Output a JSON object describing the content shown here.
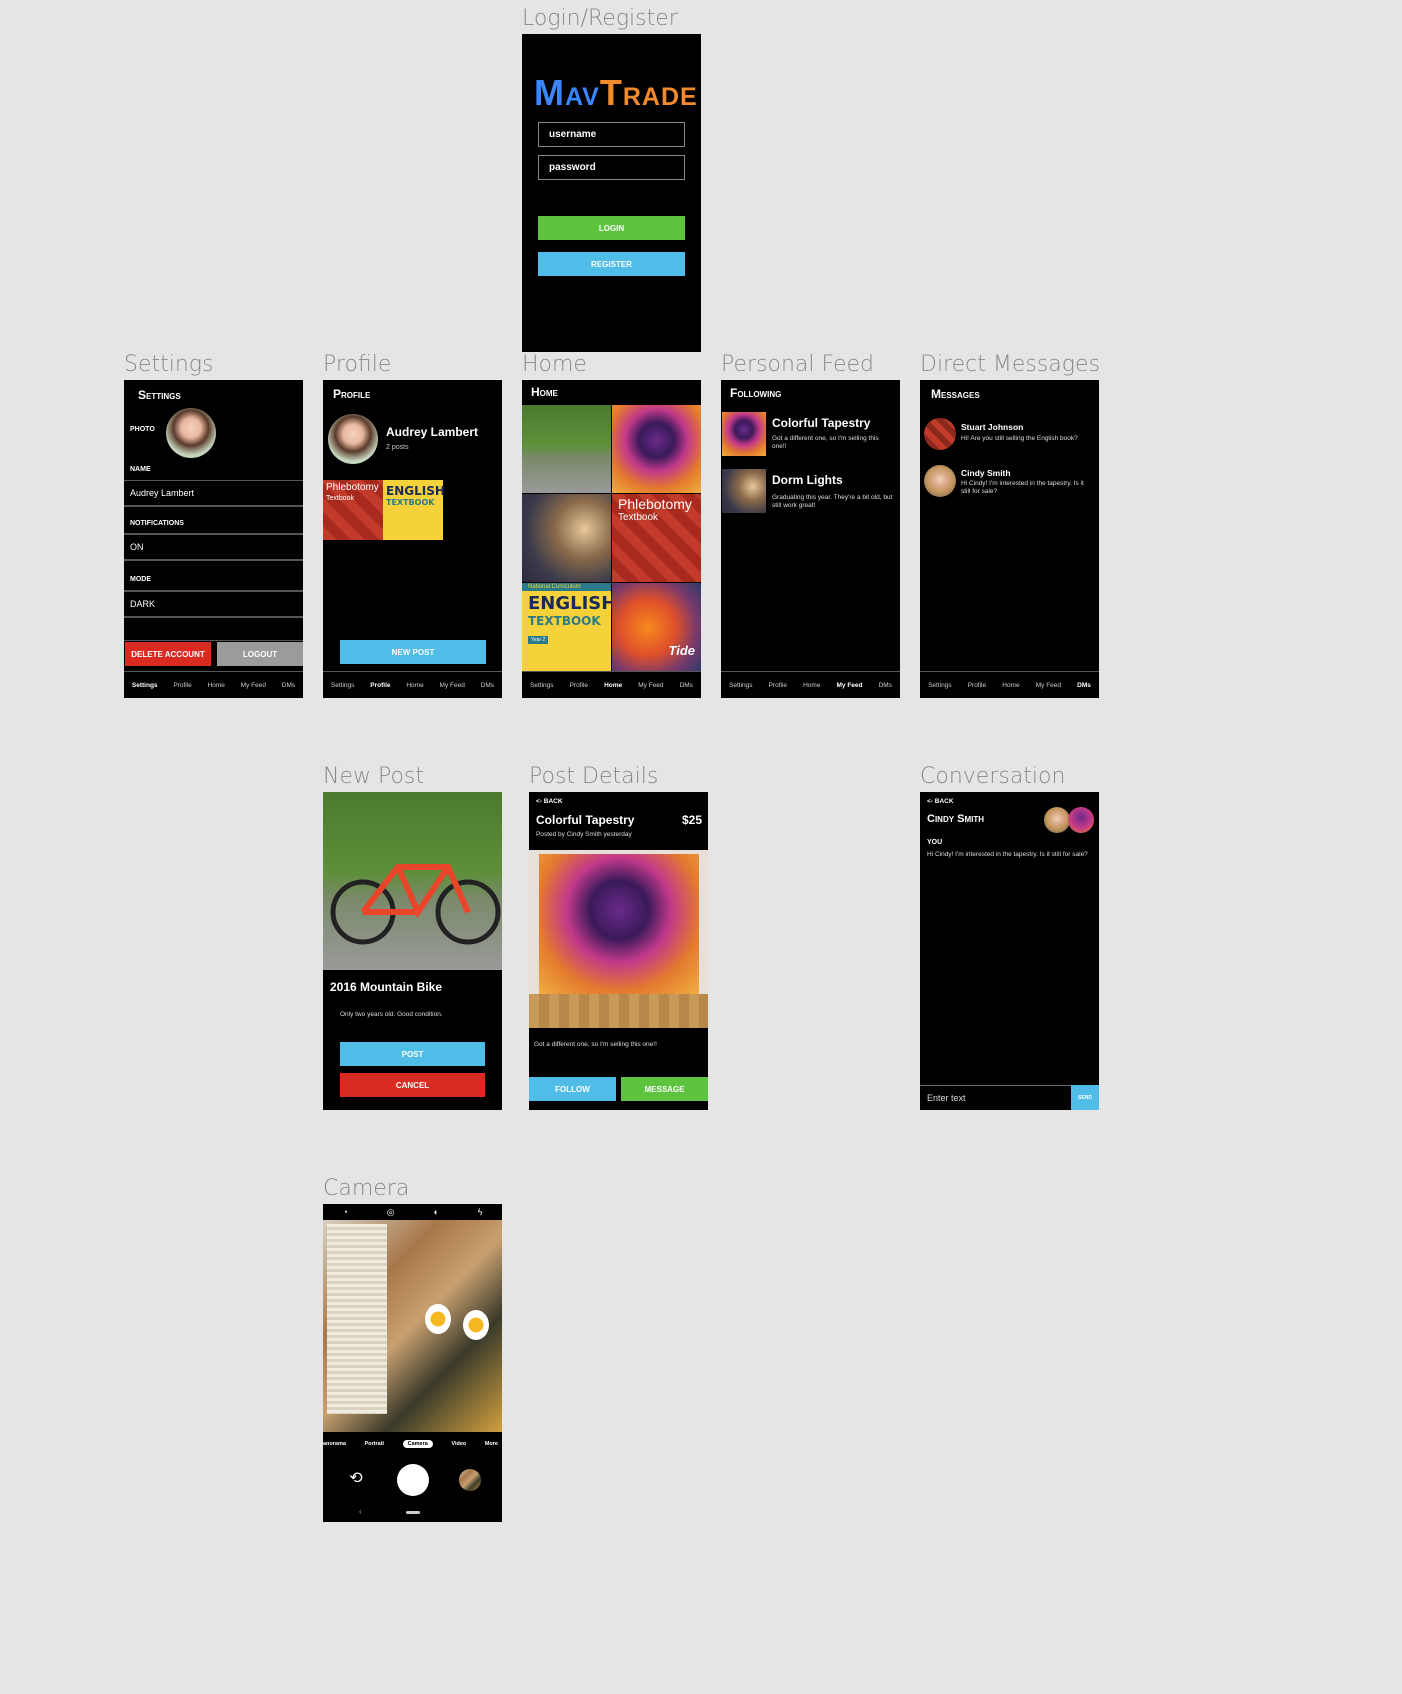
{
  "frame_labels": {
    "login": "Login/Register",
    "settings": "Settings",
    "profile": "Profile",
    "home": "Home",
    "personal_feed": "Personal Feed",
    "direct_messages": "Direct Messages",
    "new_post": "New Post",
    "post_details": "Post Details",
    "conversation": "Conversation",
    "camera": "Camera"
  },
  "login": {
    "logo_part1": "Mav",
    "logo_part2": "Trade",
    "username_placeholder": "username",
    "password_placeholder": "password",
    "login_label": "LOGIN",
    "register_label": "REGISTER"
  },
  "nav": {
    "settings": "Settings",
    "profile": "Profile",
    "home": "Home",
    "my_feed": "My Feed",
    "dms": "DMs"
  },
  "settings": {
    "title": "Settings",
    "photo_label": "PHOTO",
    "name_label": "NAME",
    "name_value": "Audrey Lambert",
    "notifications_label": "NOTIFICATIONS",
    "notifications_value": "ON",
    "mode_label": "MODE",
    "mode_value": "DARK",
    "delete_label": "DELETE ACCOUNT",
    "logout_label": "LOGOUT"
  },
  "profile": {
    "title": "Profile",
    "name": "Audrey Lambert",
    "posts": "2 posts",
    "new_post_label": "NEW POST",
    "thumb1_title": "Phlebotomy",
    "thumb1_sub": "Textbook",
    "thumb2_title": "ENGLISH",
    "thumb2_sub": "TEXTBOOK"
  },
  "home": {
    "title": "Home",
    "tile_phleb_title": "Phlebotomy",
    "tile_phleb_sub": "Textbook",
    "tile_eng_top": "National Curriculum",
    "tile_eng_title": "ENGLISH",
    "tile_eng_sub": "TEXTBOOK",
    "tile_eng_year": "Year 2",
    "tile_tide": "Tide"
  },
  "feed": {
    "title": "Following",
    "items": [
      {
        "title": "Colorful Tapestry",
        "desc": "Got a different one, so I'm selling this one!!"
      },
      {
        "title": "Dorm Lights",
        "desc": "Graduating this year. They're a bit old, but still work great!"
      }
    ]
  },
  "dms": {
    "title": "Messages",
    "items": [
      {
        "name": "Stuart Johnson",
        "msg": "Hi! Are you still selling the English book?"
      },
      {
        "name": "Cindy Smith",
        "msg": "Hi Cindy! I'm interested in the tapestry. Is it still for sale?"
      }
    ]
  },
  "new_post": {
    "title": "2016 Mountain Bike",
    "desc": "Only two years old. Good condition.",
    "post_label": "POST",
    "cancel_label": "CANCEL"
  },
  "post_details": {
    "back": "<- BACK",
    "title": "Colorful Tapestry",
    "price": "$25",
    "posted_by": "Posted by Cindy Smith yesterday",
    "desc": "Got a different one, so I'm selling this one!!",
    "follow_label": "FOLLOW",
    "message_label": "MESSAGE"
  },
  "conversation": {
    "back": "<- BACK",
    "title": "Cindy Smith",
    "sender": "YOU",
    "message": "Hi Cindy! I'm interested in the tapestry. Is it still for sale?",
    "input_placeholder": "Enter text",
    "send_label": "SEND"
  },
  "camera": {
    "modes": [
      "anorama",
      "Portrait",
      "Camera",
      "Video",
      "More"
    ],
    "top_icons": [
      "timer-icon",
      "hdr-icon",
      "white-balance-icon",
      "flash-off-icon"
    ]
  }
}
